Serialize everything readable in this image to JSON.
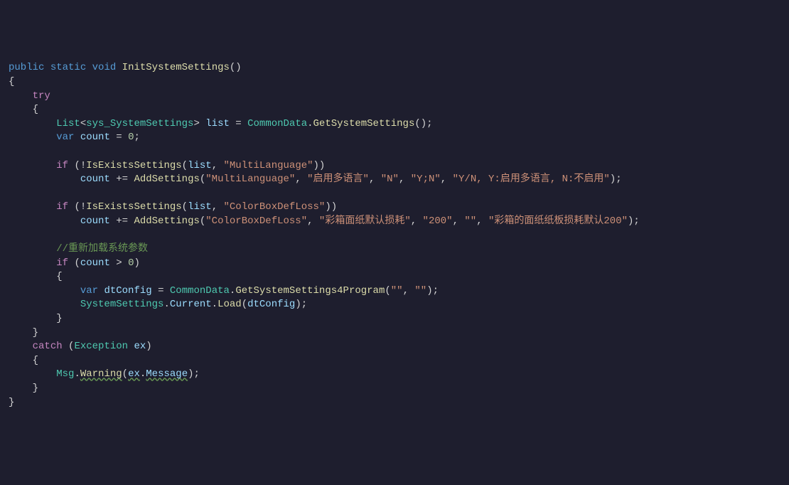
{
  "code": {
    "l1_public": "public",
    "l1_static": "static",
    "l1_void": "void",
    "l1_method": "InitSystemSettings",
    "l1_parens": "()",
    "l2_brace": "{",
    "l3_try": "try",
    "l4_brace": "{",
    "l5_List": "List",
    "l5_generic": "sys_SystemSettings",
    "l5_list": "list",
    "l5_eq": " = ",
    "l5_CommonData": "CommonData",
    "l5_GetSystemSettings": "GetSystemSettings",
    "l6_var": "var",
    "l6_count": "count",
    "l6_eq": " = ",
    "l6_zero": "0",
    "l8_if": "if",
    "l8_not": "!",
    "l8_IsExistsSettings": "IsExistsSettings",
    "l8_list": "list",
    "l8_comma": ", ",
    "l8_str": "\"MultiLanguage\"",
    "l9_count": "count",
    "l9_pluseq": " += ",
    "l9_AddSettings": "AddSettings",
    "l9_s1": "\"MultiLanguage\"",
    "l9_s2": "\"启用多语言\"",
    "l9_s3": "\"N\"",
    "l9_s4": "\"Y;N\"",
    "l9_s5": "\"Y/N, Y:启用多语言, N:不启用\"",
    "l11_if": "if",
    "l11_not": "!",
    "l11_IsExistsSettings": "IsExistsSettings",
    "l11_list": "list",
    "l11_str": "\"ColorBoxDefLoss\"",
    "l12_count": "count",
    "l12_AddSettings": "AddSettings",
    "l12_s1": "\"ColorBoxDefLoss\"",
    "l12_s2": "\"彩箱面纸默认损耗\"",
    "l12_s3": "\"200\"",
    "l12_s4": "\"\"",
    "l12_s5": "\"彩箱的面纸纸板损耗默认200\"",
    "l14_comment": "//重新加载系统参数",
    "l15_if": "if",
    "l15_count": "count",
    "l15_gt": " > ",
    "l15_zero": "0",
    "l16_brace": "{",
    "l17_var": "var",
    "l17_dtConfig": "dtConfig",
    "l17_CommonData": "CommonData",
    "l17_GetSystemSettings4Program": "GetSystemSettings4Program",
    "l17_s1": "\"\"",
    "l17_s2": "\"\"",
    "l18_SystemSettings": "SystemSettings",
    "l18_Current": "Current",
    "l18_Load": "Load",
    "l18_dtConfig": "dtConfig",
    "l19_brace": "}",
    "l20_brace": "}",
    "l21_catch": "catch",
    "l21_Exception": "Exception",
    "l21_ex": "ex",
    "l22_brace": "{",
    "l23_Msg": "Msg",
    "l23_Warning": "Warning",
    "l23_ex": "ex",
    "l23_Message": "Message",
    "l24_brace": "}",
    "l25_brace": "}"
  }
}
